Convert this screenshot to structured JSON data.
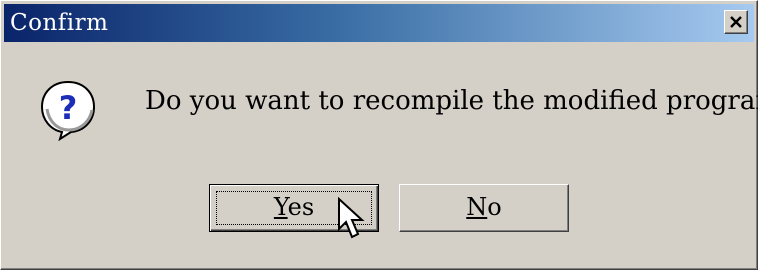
{
  "window": {
    "title": "Confirm",
    "close_icon": "close-icon"
  },
  "message": {
    "icon": "question-icon",
    "text": "Do you want to recompile the modified program?"
  },
  "buttons": {
    "yes": {
      "mnemonic": "Y",
      "rest": "es",
      "label": "Yes",
      "focused": true
    },
    "no": {
      "mnemonic": "N",
      "rest": "o",
      "label": "No"
    }
  },
  "cursor": "mouse-pointer-icon",
  "colors": {
    "titlebar_start": "#0a246a",
    "titlebar_end": "#a6caf0",
    "face": "#d4d0c8",
    "icon_blue": "#1c2eb8"
  }
}
